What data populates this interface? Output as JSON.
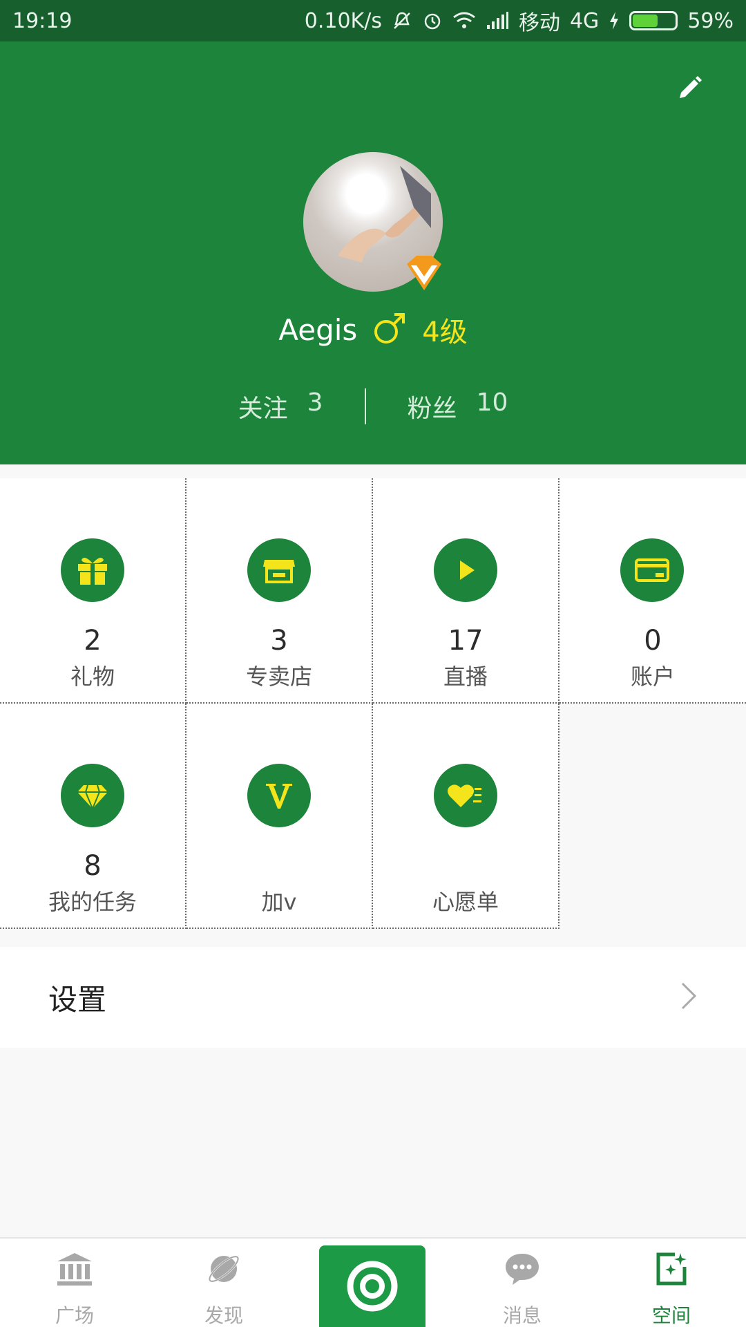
{
  "status_bar": {
    "time": "19:19",
    "network_speed": "0.10K/s",
    "carrier": "移动",
    "network_type": "4G",
    "battery_percent": "59%",
    "battery_level": 0.59
  },
  "profile": {
    "username": "Aegis",
    "gender_symbol": "♂",
    "level": "4级",
    "following_label": "关注",
    "following_count": "3",
    "fans_label": "粉丝",
    "fans_count": "10"
  },
  "grid": [
    {
      "icon": "gift-icon",
      "count": "2",
      "label": "礼物"
    },
    {
      "icon": "store-icon",
      "count": "3",
      "label": "专卖店"
    },
    {
      "icon": "play-icon",
      "count": "17",
      "label": "直播"
    },
    {
      "icon": "card-icon",
      "count": "0",
      "label": "账户"
    },
    {
      "icon": "diamond-icon",
      "count": "8",
      "label": "我的任务"
    },
    {
      "icon": "v-icon",
      "count": "",
      "label": "加v"
    },
    {
      "icon": "heart-list-icon",
      "count": "",
      "label": "心愿单"
    }
  ],
  "settings": {
    "label": "设置"
  },
  "bottom_nav": [
    {
      "icon": "bank-icon",
      "label": "广场",
      "active": false
    },
    {
      "icon": "planet-icon",
      "label": "发现",
      "active": false
    },
    {
      "icon": "camera-icon",
      "label": "",
      "active": false
    },
    {
      "icon": "chat-icon",
      "label": "消息",
      "active": false
    },
    {
      "icon": "space-icon",
      "label": "空间",
      "active": true
    }
  ],
  "colors": {
    "brand_green": "#1d843b",
    "accent_yellow": "#f4e41c"
  }
}
